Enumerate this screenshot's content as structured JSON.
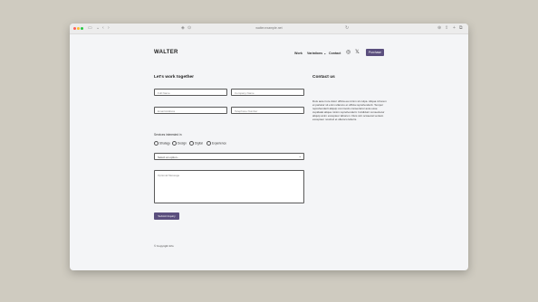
{
  "browser": {
    "url": "walter.example.net"
  },
  "header": {
    "logo": "WALTER",
    "nav": {
      "work": "Work",
      "variations": "Variations",
      "contact": "Contact"
    },
    "purchase_label": "Purchase",
    "icons": [
      "instagram-icon",
      "x-icon"
    ]
  },
  "form": {
    "title": "Let's work together",
    "full_name_placeholder": "Full Name",
    "company_placeholder": "Company Name",
    "email_placeholder": "Email Address",
    "phone_placeholder": "Telephone Number",
    "services_label": "Services interested in",
    "services": [
      "Strategy",
      "Design",
      "Digital",
      "Experience"
    ],
    "select_value": "Select an option...",
    "message_placeholder": "Optional Message",
    "submit_label": "Submit Inquiry"
  },
  "contact": {
    "title": "Contact us",
    "body": "Duis aute irure dolor officia ea minim sit culpa. Aliqua id lorem et pariatur sit enim ullamco et officia reprehenderit. Tempor reprehenderit aliquip commodo consectetur aute esse cupidatat aliqua minim reprehenderit. Incididunt consectetur aliquip anim excepteur laborum. Duis sint occaecat veniam excepteur nostrud et ullamco laboris."
  },
  "footer": {
    "copyright": "© Copyright Info"
  }
}
